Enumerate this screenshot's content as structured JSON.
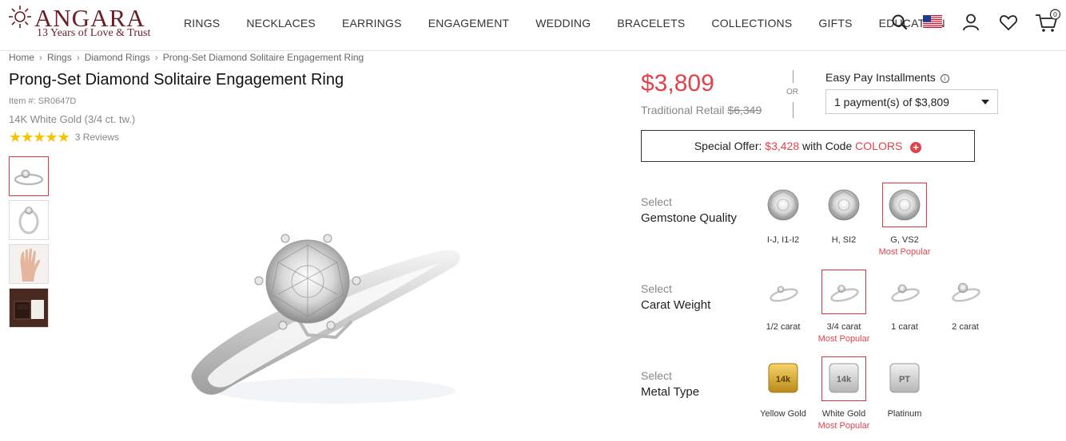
{
  "header": {
    "brand": "ANGARA",
    "tagline": "13 Years of Love & Trust",
    "nav": [
      "RINGS",
      "NECKLACES",
      "EARRINGS",
      "ENGAGEMENT",
      "WEDDING",
      "BRACELETS",
      "COLLECTIONS",
      "GIFTS",
      "EDUCATION"
    ],
    "cart_count": "0",
    "icons": [
      "search-icon",
      "us-flag-icon",
      "account-icon",
      "wishlist-heart-icon",
      "cart-icon"
    ]
  },
  "breadcrumb": [
    "Home",
    "Rings",
    "Diamond Rings",
    "Prong-Set Diamond Solitaire Engagement Ring"
  ],
  "product": {
    "title": "Prong-Set Diamond Solitaire Engagement Ring",
    "item_no": "Item #: SR0647D",
    "metal_summary": "14K White Gold (3/4 ct. tw.)",
    "rating": 5,
    "reviews": "3 Reviews"
  },
  "pricing": {
    "price": "$3,809",
    "retail_label": "Traditional Retail",
    "retail_price": "$6,349",
    "or": "OR",
    "easy_pay_label": "Easy Pay Installments",
    "installment_selected": "1 payment(s) of $3,809"
  },
  "offer": {
    "prefix": "Special Offer:",
    "amount": "$3,428",
    "middle": "with Code",
    "code": "COLORS"
  },
  "options": {
    "select_word": "Select",
    "gemstone": {
      "label": "Gemstone Quality",
      "choices": [
        {
          "name": "I-J, I1-I2",
          "selected": false,
          "popular": ""
        },
        {
          "name": "H, SI2",
          "selected": false,
          "popular": ""
        },
        {
          "name": "G, VS2",
          "selected": true,
          "popular": "Most Popular"
        }
      ]
    },
    "carat": {
      "label": "Carat Weight",
      "choices": [
        {
          "name": "1/2 carat",
          "selected": false,
          "popular": ""
        },
        {
          "name": "3/4 carat",
          "selected": true,
          "popular": "Most Popular"
        },
        {
          "name": "1 carat",
          "selected": false,
          "popular": ""
        },
        {
          "name": "2 carat",
          "selected": false,
          "popular": ""
        }
      ]
    },
    "metal": {
      "label": "Metal Type",
      "choices": [
        {
          "name": "Yellow Gold",
          "badge": "14k",
          "selected": false,
          "popular": ""
        },
        {
          "name": "White Gold",
          "badge": "14k",
          "selected": true,
          "popular": "Most Popular"
        },
        {
          "name": "Platinum",
          "badge": "PT",
          "selected": false,
          "popular": ""
        }
      ]
    }
  },
  "colors": {
    "accent_red": "#e1434b",
    "brand_maroon": "#6b1e24",
    "star_gold": "#f5c400"
  }
}
